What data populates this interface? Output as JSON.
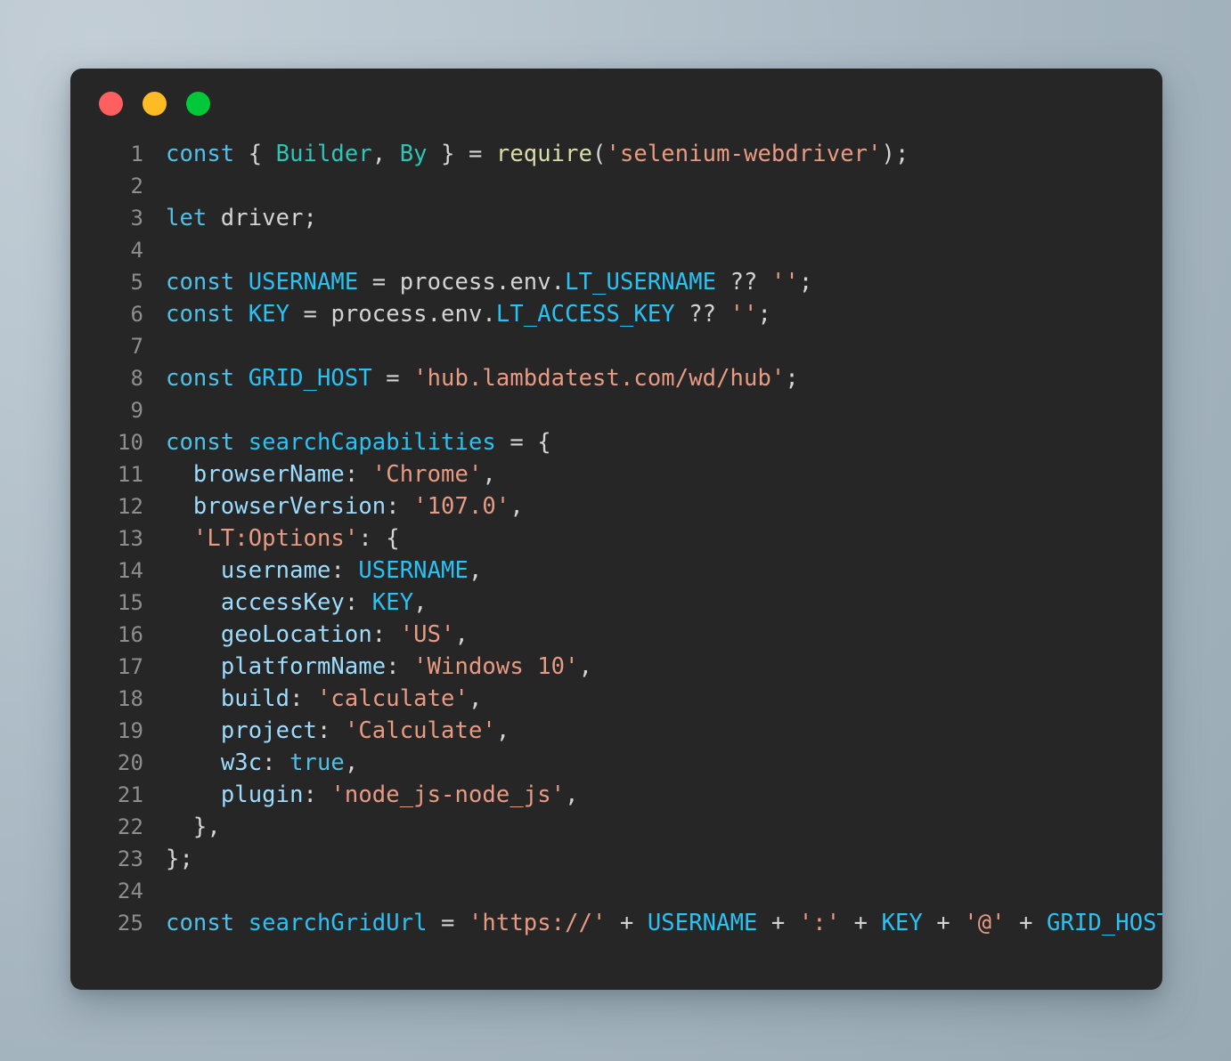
{
  "window": {
    "name": "code-snippet-window",
    "background_color": "#262626",
    "page_background_color": "#aebcc6",
    "controls": [
      {
        "name": "close-button",
        "label": "Close",
        "color": "#ff5f5f"
      },
      {
        "name": "minimize-button",
        "label": "Minimize",
        "color": "#fdbc24"
      },
      {
        "name": "maximize-button",
        "label": "Maximize",
        "color": "#00c838"
      }
    ]
  },
  "editor": {
    "language": "javascript",
    "line_number_color": "#8e8e8e",
    "first_line_number": 1,
    "last_line_number": 25,
    "palette": {
      "keyword": "#4fc1e9",
      "identifier": "#29c2f5",
      "class": "#2ec4b6",
      "function": "#dcdcaa",
      "string": "#e89a82",
      "property": "#9cdcfe",
      "plain": "#d4d4d4"
    },
    "lines": [
      {
        "n": "1",
        "tokens": [
          {
            "t": "const",
            "c": "kw"
          },
          {
            "t": " ",
            "c": "plain"
          },
          {
            "t": "{",
            "c": "punct"
          },
          {
            "t": " ",
            "c": "plain"
          },
          {
            "t": "Builder",
            "c": "cls"
          },
          {
            "t": ",",
            "c": "plain"
          },
          {
            "t": " ",
            "c": "plain"
          },
          {
            "t": "By",
            "c": "cls"
          },
          {
            "t": " ",
            "c": "plain"
          },
          {
            "t": "}",
            "c": "punct"
          },
          {
            "t": " = ",
            "c": "plain"
          },
          {
            "t": "require",
            "c": "fn"
          },
          {
            "t": "(",
            "c": "punct"
          },
          {
            "t": "'selenium-webdriver'",
            "c": "str"
          },
          {
            "t": ")",
            "c": "punct"
          },
          {
            "t": ";",
            "c": "plain"
          }
        ]
      },
      {
        "n": "2",
        "tokens": []
      },
      {
        "n": "3",
        "tokens": [
          {
            "t": "let",
            "c": "kw"
          },
          {
            "t": " driver;",
            "c": "plain"
          }
        ]
      },
      {
        "n": "4",
        "tokens": []
      },
      {
        "n": "5",
        "tokens": [
          {
            "t": "const",
            "c": "kw"
          },
          {
            "t": " ",
            "c": "plain"
          },
          {
            "t": "USERNAME",
            "c": "id"
          },
          {
            "t": " = ",
            "c": "plain"
          },
          {
            "t": "process.env.",
            "c": "plain"
          },
          {
            "t": "LT_USERNAME",
            "c": "id"
          },
          {
            "t": " ?? ",
            "c": "plain"
          },
          {
            "t": "''",
            "c": "str"
          },
          {
            "t": ";",
            "c": "plain"
          }
        ]
      },
      {
        "n": "6",
        "tokens": [
          {
            "t": "const",
            "c": "kw"
          },
          {
            "t": " ",
            "c": "plain"
          },
          {
            "t": "KEY",
            "c": "id"
          },
          {
            "t": " = ",
            "c": "plain"
          },
          {
            "t": "process.env.",
            "c": "plain"
          },
          {
            "t": "LT_ACCESS_KEY",
            "c": "id"
          },
          {
            "t": " ?? ",
            "c": "plain"
          },
          {
            "t": "''",
            "c": "str"
          },
          {
            "t": ";",
            "c": "plain"
          }
        ]
      },
      {
        "n": "7",
        "tokens": []
      },
      {
        "n": "8",
        "tokens": [
          {
            "t": "const",
            "c": "kw"
          },
          {
            "t": " ",
            "c": "plain"
          },
          {
            "t": "GRID_HOST",
            "c": "id"
          },
          {
            "t": " = ",
            "c": "plain"
          },
          {
            "t": "'hub.lambdatest.com/wd/hub'",
            "c": "str"
          },
          {
            "t": ";",
            "c": "plain"
          }
        ]
      },
      {
        "n": "9",
        "tokens": []
      },
      {
        "n": "10",
        "tokens": [
          {
            "t": "const",
            "c": "kw"
          },
          {
            "t": " ",
            "c": "plain"
          },
          {
            "t": "searchCapabilities",
            "c": "id"
          },
          {
            "t": " = {",
            "c": "plain"
          }
        ]
      },
      {
        "n": "11",
        "tokens": [
          {
            "t": "  ",
            "c": "plain"
          },
          {
            "t": "browserName",
            "c": "prop"
          },
          {
            "t": ": ",
            "c": "plain"
          },
          {
            "t": "'Chrome'",
            "c": "str"
          },
          {
            "t": ",",
            "c": "plain"
          }
        ]
      },
      {
        "n": "12",
        "tokens": [
          {
            "t": "  ",
            "c": "plain"
          },
          {
            "t": "browserVersion",
            "c": "prop"
          },
          {
            "t": ": ",
            "c": "plain"
          },
          {
            "t": "'107.0'",
            "c": "str"
          },
          {
            "t": ",",
            "c": "plain"
          }
        ]
      },
      {
        "n": "13",
        "tokens": [
          {
            "t": "  ",
            "c": "plain"
          },
          {
            "t": "'LT:Options'",
            "c": "str"
          },
          {
            "t": ": ",
            "c": "plain"
          },
          {
            "t": "{",
            "c": "punct"
          }
        ]
      },
      {
        "n": "14",
        "tokens": [
          {
            "t": "    ",
            "c": "plain"
          },
          {
            "t": "username",
            "c": "prop"
          },
          {
            "t": ": ",
            "c": "plain"
          },
          {
            "t": "USERNAME",
            "c": "id"
          },
          {
            "t": ",",
            "c": "plain"
          }
        ]
      },
      {
        "n": "15",
        "tokens": [
          {
            "t": "    ",
            "c": "plain"
          },
          {
            "t": "accessKey",
            "c": "prop"
          },
          {
            "t": ": ",
            "c": "plain"
          },
          {
            "t": "KEY",
            "c": "id"
          },
          {
            "t": ",",
            "c": "plain"
          }
        ]
      },
      {
        "n": "16",
        "tokens": [
          {
            "t": "    ",
            "c": "plain"
          },
          {
            "t": "geoLocation",
            "c": "prop"
          },
          {
            "t": ": ",
            "c": "plain"
          },
          {
            "t": "'US'",
            "c": "str"
          },
          {
            "t": ",",
            "c": "plain"
          }
        ]
      },
      {
        "n": "17",
        "tokens": [
          {
            "t": "    ",
            "c": "plain"
          },
          {
            "t": "platformName",
            "c": "prop"
          },
          {
            "t": ": ",
            "c": "plain"
          },
          {
            "t": "'Windows 10'",
            "c": "str"
          },
          {
            "t": ",",
            "c": "plain"
          }
        ]
      },
      {
        "n": "18",
        "tokens": [
          {
            "t": "    ",
            "c": "plain"
          },
          {
            "t": "build",
            "c": "prop"
          },
          {
            "t": ": ",
            "c": "plain"
          },
          {
            "t": "'calculate'",
            "c": "str"
          },
          {
            "t": ",",
            "c": "plain"
          }
        ]
      },
      {
        "n": "19",
        "tokens": [
          {
            "t": "    ",
            "c": "plain"
          },
          {
            "t": "project",
            "c": "prop"
          },
          {
            "t": ": ",
            "c": "plain"
          },
          {
            "t": "'Calculate'",
            "c": "str"
          },
          {
            "t": ",",
            "c": "plain"
          }
        ]
      },
      {
        "n": "20",
        "tokens": [
          {
            "t": "    ",
            "c": "plain"
          },
          {
            "t": "w3c",
            "c": "prop"
          },
          {
            "t": ": ",
            "c": "plain"
          },
          {
            "t": "true",
            "c": "kw"
          },
          {
            "t": ",",
            "c": "plain"
          }
        ]
      },
      {
        "n": "21",
        "tokens": [
          {
            "t": "    ",
            "c": "plain"
          },
          {
            "t": "plugin",
            "c": "prop"
          },
          {
            "t": ": ",
            "c": "plain"
          },
          {
            "t": "'node_js-node_js'",
            "c": "str"
          },
          {
            "t": ",",
            "c": "plain"
          }
        ]
      },
      {
        "n": "22",
        "tokens": [
          {
            "t": "  },",
            "c": "plain"
          }
        ]
      },
      {
        "n": "23",
        "tokens": [
          {
            "t": "};",
            "c": "plain"
          }
        ]
      },
      {
        "n": "24",
        "tokens": []
      },
      {
        "n": "25",
        "tokens": [
          {
            "t": "const",
            "c": "kw"
          },
          {
            "t": " ",
            "c": "plain"
          },
          {
            "t": "searchGridUrl",
            "c": "id"
          },
          {
            "t": " = ",
            "c": "plain"
          },
          {
            "t": "'https://'",
            "c": "str"
          },
          {
            "t": " + ",
            "c": "plain"
          },
          {
            "t": "USERNAME",
            "c": "id"
          },
          {
            "t": " + ",
            "c": "plain"
          },
          {
            "t": "':'",
            "c": "str"
          },
          {
            "t": " + ",
            "c": "plain"
          },
          {
            "t": "KEY",
            "c": "id"
          },
          {
            "t": " + ",
            "c": "plain"
          },
          {
            "t": "'@'",
            "c": "str"
          },
          {
            "t": " + ",
            "c": "plain"
          },
          {
            "t": "GRID_HOST",
            "c": "id"
          },
          {
            "t": ";",
            "c": "plain"
          }
        ]
      }
    ]
  }
}
